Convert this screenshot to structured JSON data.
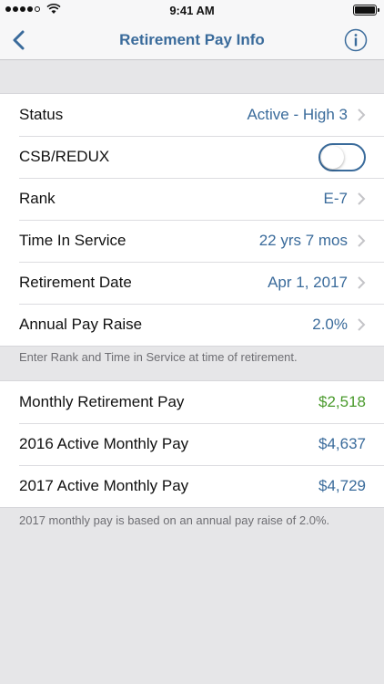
{
  "status_bar": {
    "time": "9:41 AM"
  },
  "nav": {
    "title": "Retirement Pay Info"
  },
  "settings": [
    {
      "label": "Status",
      "value": "Active - High 3"
    },
    {
      "label": "CSB/REDUX",
      "toggle_on": false
    },
    {
      "label": "Rank",
      "value": "E-7"
    },
    {
      "label": "Time In Service",
      "value": "22 yrs 7 mos"
    },
    {
      "label": "Retirement Date",
      "value": "Apr 1, 2017"
    },
    {
      "label": "Annual Pay Raise",
      "value": "2.0%"
    }
  ],
  "settings_footnote": "Enter Rank and Time in Service at time of retirement.",
  "results": [
    {
      "label": "Monthly Retirement Pay",
      "value": "$2,518"
    },
    {
      "label": "2016 Active Monthly Pay",
      "value": "$4,637"
    },
    {
      "label": "2017 Active Monthly Pay",
      "value": "$4,729"
    }
  ],
  "results_footnote": "2017 monthly pay is based on an annual pay raise of 2.0%.",
  "colors": {
    "accent": "#3a6b9b",
    "positive": "#4a9a2c",
    "background": "#e6e6e8"
  }
}
